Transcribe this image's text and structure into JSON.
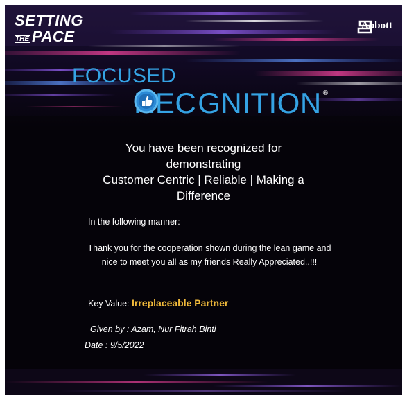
{
  "branding": {
    "campaign_line1": "SETTING",
    "campaign_the": "THE",
    "campaign_line2": "PACE",
    "company_name": "Abbott",
    "program_line1": "FOCUSED",
    "program_part1": "REC",
    "program_part2": "GNITION",
    "registered_mark": "®",
    "badge_icon": "thumbs-up-icon"
  },
  "recognition": {
    "headline_lines": [
      "You have been recognized for",
      "demonstrating",
      "Customer Centric | Reliable | Making a",
      "Difference"
    ],
    "manner_label": "In the following manner:",
    "message": "Thank you for the cooperation shown during the lean game and nice to meet you all as my friends Really Appreciated..!!!",
    "key_value_label": "Key Value:",
    "key_value": "Irreplaceable Partner",
    "given_by": "Given by : Azam, Nur Fitrah Binti",
    "date": "Date : 9/5/2022"
  },
  "colors": {
    "background": "#050309",
    "brand_blue": "#35a3e4",
    "key_value_gold": "#f0b93a",
    "text": "#ffffff"
  }
}
